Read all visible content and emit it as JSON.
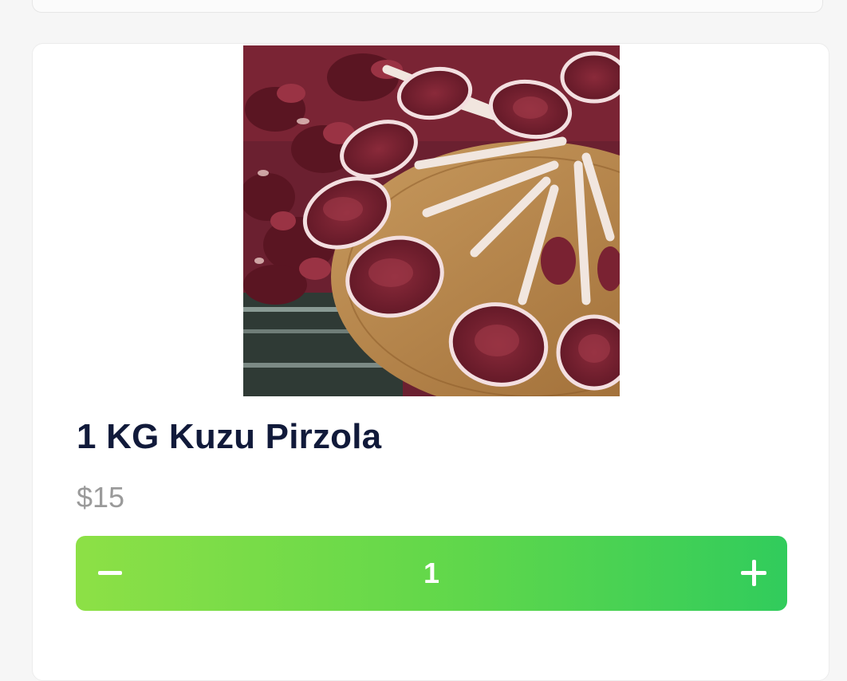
{
  "product": {
    "name": "1 KG Kuzu Pirzola",
    "price": "$15",
    "image_icon": "lamb-chops-photo"
  },
  "stepper": {
    "quantity": "1",
    "decrement_icon": "minus-icon",
    "increment_icon": "plus-icon",
    "colors": {
      "start": "#8de046",
      "end": "#31cc5c"
    }
  },
  "colors": {
    "title": "#111a3a",
    "price": "#9a9a9a",
    "background": "#f6f6f6",
    "card": "#ffffff"
  }
}
